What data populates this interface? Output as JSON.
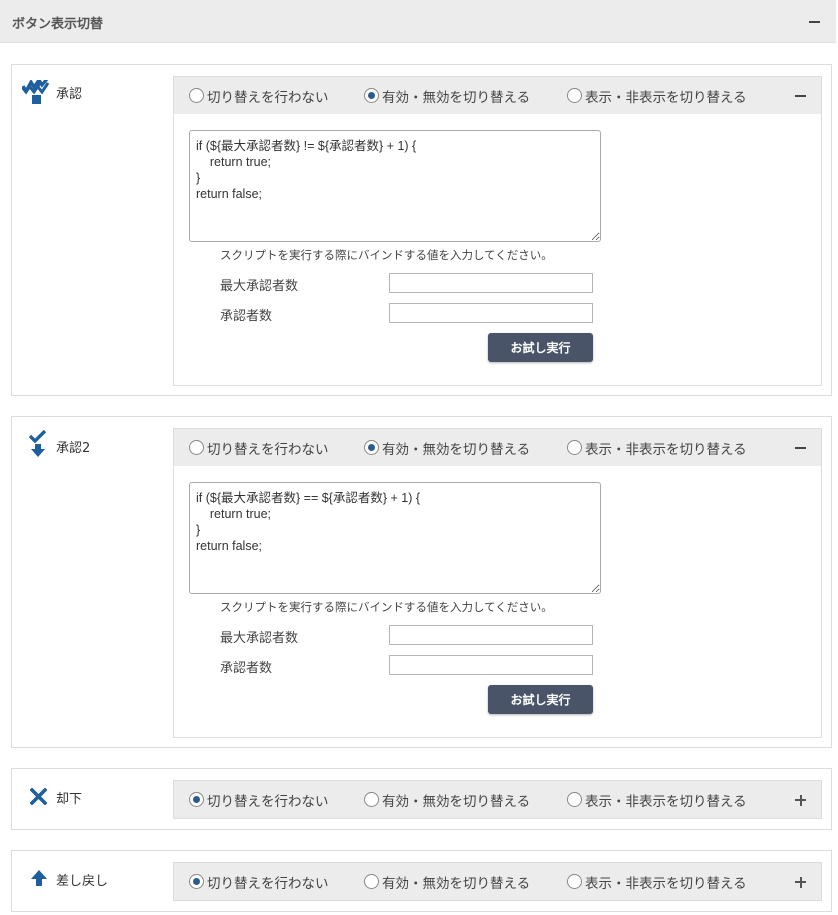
{
  "section": {
    "title": "ボタン表示切替"
  },
  "radio_options": [
    "切り替えを行わない",
    "有効・無効を切り替える",
    "表示・非表示を切り替える"
  ],
  "hint_text": "スクリプトを実行する際にバインドする値を入力してください。",
  "field_labels": [
    "最大承認者数",
    "承認者数"
  ],
  "run_label": "お試し実行",
  "cards": [
    {
      "label": "承認",
      "icon": "approve-multi-icon",
      "selected": 1,
      "expanded": true,
      "script": "if (${最大承認者数} != ${承認者数} + 1) {\n    return true;\n}\nreturn false;"
    },
    {
      "label": "承認2",
      "icon": "check-down-arrow-icon",
      "selected": 1,
      "expanded": true,
      "script": "if (${最大承認者数} == ${承認者数} + 1) {\n    return true;\n}\nreturn false;"
    },
    {
      "label": "却下",
      "icon": "reject-x-icon",
      "selected": 0,
      "expanded": false
    },
    {
      "label": "差し戻し",
      "icon": "sendback-up-arrow-icon",
      "selected": 0,
      "expanded": false
    }
  ],
  "colors": {
    "accent": "#2a5a8f",
    "icon_blue": "#1f5f9e",
    "button": "#4a5468",
    "header_bg": "#ececec"
  }
}
